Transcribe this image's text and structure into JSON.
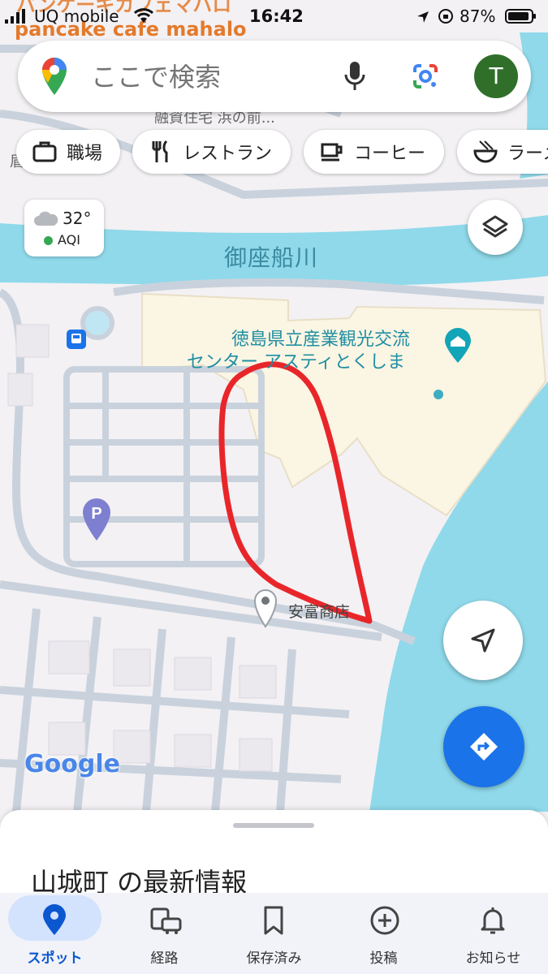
{
  "status_bar": {
    "overlay_text": "パンケーキカフェマハロ",
    "carrier": "UQ mobile",
    "time": "16:42",
    "battery": "87%"
  },
  "search": {
    "placeholder": "ここで検索",
    "avatar_letter": "T"
  },
  "chips": [
    {
      "label": "職場",
      "icon": "briefcase-icon"
    },
    {
      "label": "レストラン",
      "icon": "fork-knife-icon"
    },
    {
      "label": "コーヒー",
      "icon": "coffee-cup-icon"
    },
    {
      "label": "ラーメ",
      "icon": "ramen-bowl-icon"
    }
  ],
  "weather": {
    "temp": "32°",
    "aqi_label": "AQI",
    "aqi_color": "#34a853"
  },
  "map": {
    "top_label": "pancake cafe mahalo",
    "partial_label": "融資住宅 浜の前...",
    "river_label": "御座船川",
    "place_name_line1": "徳島県立産業観光交流",
    "place_name_line2": "センター アスティとくしま",
    "shop_label": "安富商店",
    "partial_side_label": "眉",
    "colors": {
      "water": "#8fd9ea",
      "land": "#f3f1f4",
      "road": "#c9d2dc",
      "building": "#fbf5e3",
      "annotation": "#e8262a",
      "pin": "#3dadc1",
      "parking": "#7e7fd0"
    }
  },
  "brand": "Google",
  "sheet": {
    "title": "山城町 の最新情報"
  },
  "bottom_nav": [
    {
      "label": "スポット",
      "icon": "location-pin-icon",
      "active": true
    },
    {
      "label": "経路",
      "icon": "car-transit-icon"
    },
    {
      "label": "保存済み",
      "icon": "bookmark-icon"
    },
    {
      "label": "投稿",
      "icon": "add-circle-icon"
    },
    {
      "label": "お知らせ",
      "icon": "bell-icon"
    }
  ]
}
